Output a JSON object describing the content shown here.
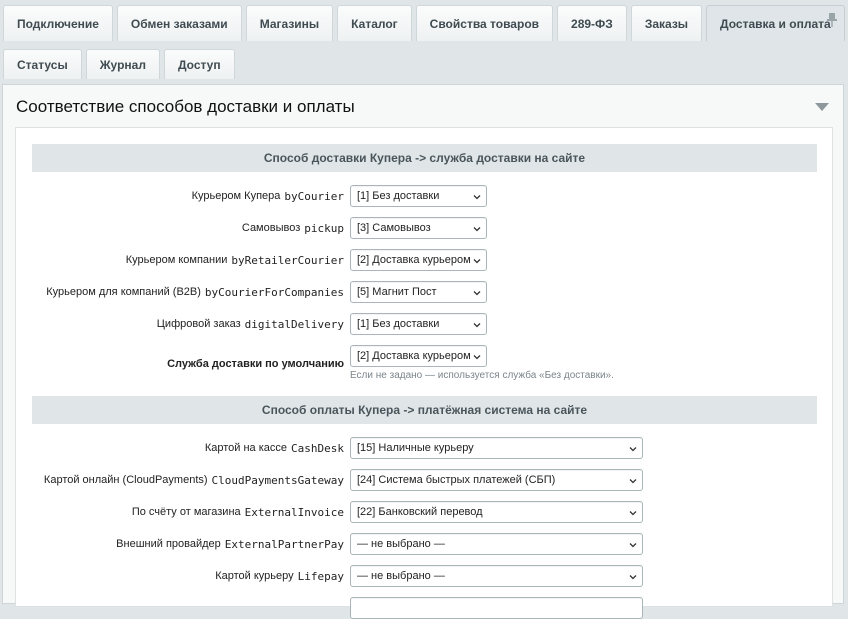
{
  "top_tabs": [
    {
      "label": "Подключение",
      "active": false
    },
    {
      "label": "Обмен заказами",
      "active": false
    },
    {
      "label": "Магазины",
      "active": false
    },
    {
      "label": "Каталог",
      "active": false
    },
    {
      "label": "Свойства товаров",
      "active": false
    },
    {
      "label": "289-ФЗ",
      "active": false
    },
    {
      "label": "Заказы",
      "active": false
    },
    {
      "label": "Доставка и оплата",
      "active": true
    }
  ],
  "sub_tabs": [
    {
      "label": "Статусы"
    },
    {
      "label": "Журнал"
    },
    {
      "label": "Доступ"
    }
  ],
  "section": {
    "title": "Соответствие способов доставки и оплаты"
  },
  "delivery": {
    "heading": "Способ доставки Купера -> служба доставки на сайте",
    "rows": [
      {
        "label": "Курьером Купера",
        "code": "byCourier",
        "value": "[1] Без доставки"
      },
      {
        "label": "Самовывоз",
        "code": "pickup",
        "value": "[3] Самовывоз"
      },
      {
        "label": "Курьером компании",
        "code": "byRetailerCourier",
        "value": "[2] Доставка курьером"
      },
      {
        "label": "Курьером для компаний (B2B)",
        "code": "byCourierForCompanies",
        "value": "[5] Магнит Пост"
      },
      {
        "label": "Цифровой заказ",
        "code": "digitalDelivery",
        "value": "[1] Без доставки"
      }
    ],
    "default": {
      "label": "Служба доставки по умолчанию",
      "value": "[2] Доставка курьером",
      "hint": "Если не задано — используется служба «Без доставки»."
    }
  },
  "payment": {
    "heading": "Способ оплаты Купера -> платёжная система на сайте",
    "rows": [
      {
        "label": "Картой на кассе",
        "code": "CashDesk",
        "value": "[15] Наличные курьеру"
      },
      {
        "label": "Картой онлайн (CloudPayments)",
        "code": "CloudPaymentsGateway",
        "value": "[24] Система быстрых платежей (СБП)"
      },
      {
        "label": "По счёту от магазина",
        "code": "ExternalInvoice",
        "value": "[22] Банковский перевод"
      },
      {
        "label": "Внешний провайдер",
        "code": "ExternalPartnerPay",
        "value": "— не выбрано —"
      },
      {
        "label": "Картой курьеру",
        "code": "Lifepay",
        "value": "— не выбрано —"
      }
    ]
  },
  "icons": {
    "pin": "pin-icon",
    "collapse": "collapse-triangle-icon",
    "select_arrow": "chevron-down-icon"
  },
  "colors": {
    "page_bg": "#e0e6e8",
    "group_header_bg": "#e0e6e8",
    "active_tab_bg": "#dfe5e8"
  }
}
